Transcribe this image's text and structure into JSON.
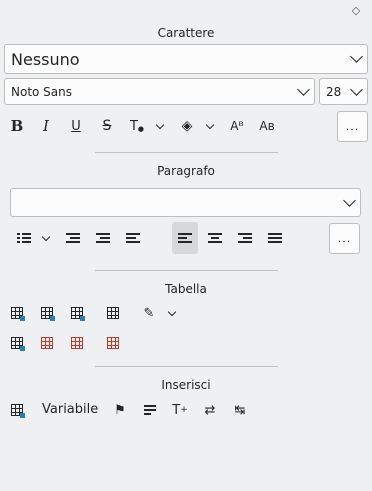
{
  "sections": {
    "character": "Carattere",
    "paragraph": "Paragrafo",
    "table": "Tabella",
    "insert": "Inserisci"
  },
  "character": {
    "style_value": "Nessuno",
    "font_value": "Noto Sans",
    "size_value": "28",
    "more_label": "..."
  },
  "paragraph": {
    "style_value": "",
    "more_label": "..."
  },
  "insert": {
    "variable_label": "Variabile"
  },
  "icons": {
    "bold": "B",
    "italic": "I",
    "underline": "U",
    "strike": "S",
    "superscript": "Aᴮ",
    "subscript": "Aʙ",
    "font_color": "T",
    "pin": "◇"
  },
  "colors": {
    "background": "#eff0f1",
    "field_background": "#fcfcfc",
    "active_button": "#d6d8da",
    "table_accent_blue": "#2980b9",
    "table_accent_red": "#c0392b"
  }
}
